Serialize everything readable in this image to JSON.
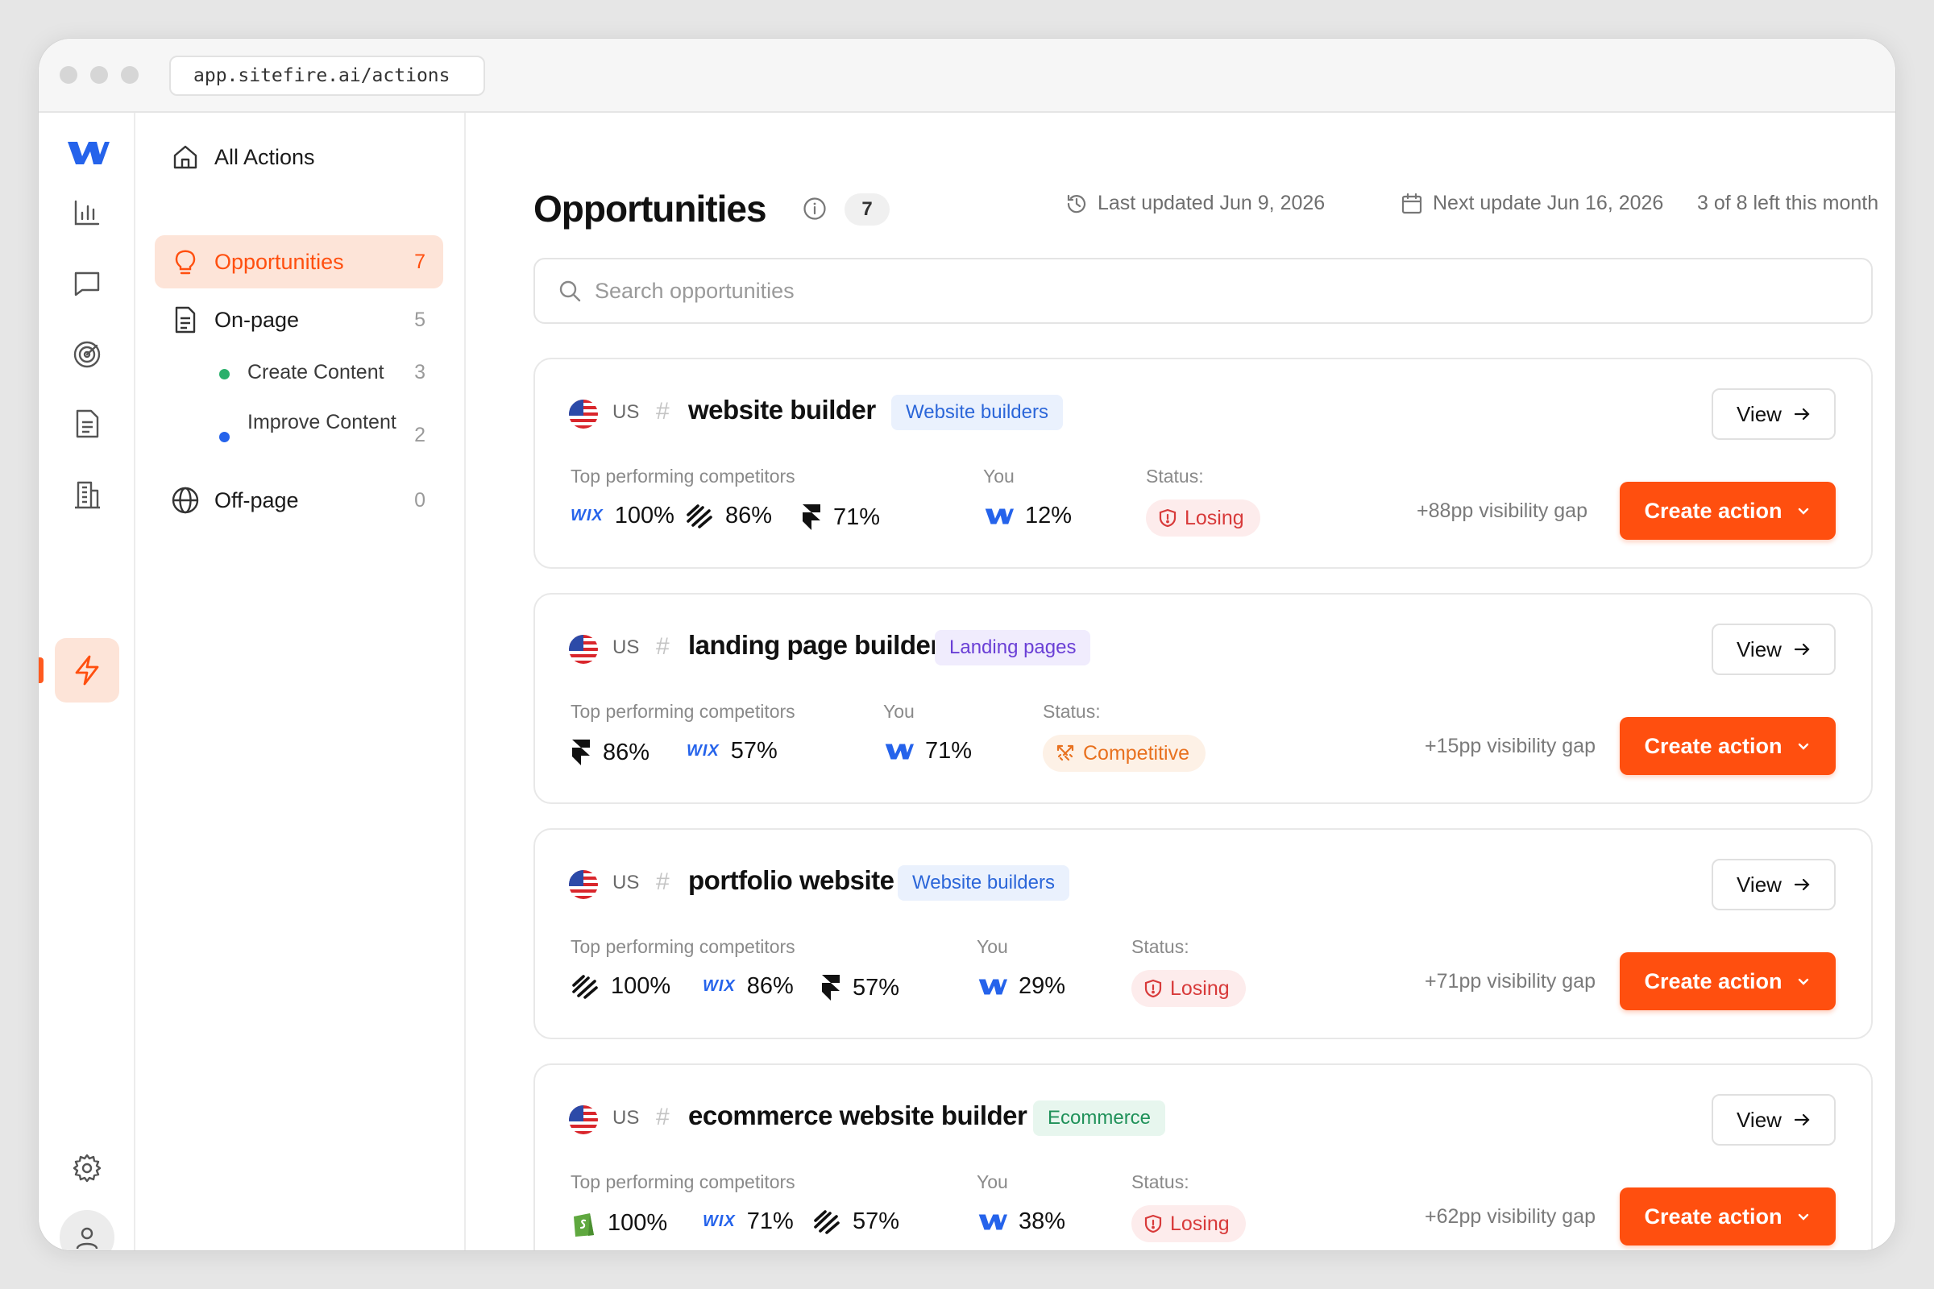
{
  "browser": {
    "url": "app.sitefire.ai/actions"
  },
  "sidebar": {
    "items": [
      {
        "label": "All Actions",
        "count": "",
        "icon": "home-icon"
      },
      {
        "label": "Opportunities",
        "count": "7",
        "icon": "lightbulb-icon",
        "active": true
      },
      {
        "label": "On-page",
        "count": "5",
        "icon": "document-icon"
      },
      {
        "label": "Off-page",
        "count": "0",
        "icon": "globe-icon"
      }
    ],
    "subitems": [
      {
        "label": "Create Content",
        "count": "3",
        "dot_color": "#2ab06b"
      },
      {
        "label": "Improve Content",
        "count": "2",
        "dot_color": "#2563eb"
      }
    ]
  },
  "page": {
    "title": "Opportunities",
    "count": "7",
    "last_updated": "Last updated Jun 9, 2026",
    "next_update": "Next update Jun 16, 2026",
    "quota": "3 of 8 left this month",
    "search_placeholder": "Search opportunities"
  },
  "labels": {
    "competitors": "Top performing competitors",
    "you": "You",
    "status": "Status:",
    "view": "View",
    "create_action": "Create action"
  },
  "cards": [
    {
      "country": "US",
      "keyword": "website builder",
      "tag": "Website builders",
      "tag_color": "blue",
      "competitors": [
        {
          "logo": "wix",
          "pct": "100%"
        },
        {
          "logo": "squarespace",
          "pct": "86%"
        },
        {
          "logo": "framer",
          "pct": "71%"
        }
      ],
      "you": "12%",
      "status": "Losing",
      "gap": "+88pp visibility gap"
    },
    {
      "country": "US",
      "keyword": "landing page builder",
      "tag": "Landing pages",
      "tag_color": "purple",
      "competitors": [
        {
          "logo": "framer",
          "pct": "86%"
        },
        {
          "logo": "wix",
          "pct": "57%"
        }
      ],
      "you": "71%",
      "status": "Competitive",
      "gap": "+15pp visibility gap"
    },
    {
      "country": "US",
      "keyword": "portfolio website",
      "tag": "Website builders",
      "tag_color": "blue",
      "competitors": [
        {
          "logo": "squarespace",
          "pct": "100%"
        },
        {
          "logo": "wix",
          "pct": "86%"
        },
        {
          "logo": "framer",
          "pct": "57%"
        }
      ],
      "you": "29%",
      "status": "Losing",
      "gap": "+71pp visibility gap"
    },
    {
      "country": "US",
      "keyword": "ecommerce website builder",
      "tag": "Ecommerce",
      "tag_color": "green",
      "competitors": [
        {
          "logo": "shopify",
          "pct": "100%"
        },
        {
          "logo": "wix",
          "pct": "71%"
        },
        {
          "logo": "squarespace",
          "pct": "57%"
        }
      ],
      "you": "38%",
      "status": "Losing",
      "gap": "+62pp visibility gap"
    }
  ],
  "colors": {
    "accent": "#ff4f0f",
    "accent_soft": "#fde4d8",
    "webflow_blue": "#2563eb"
  }
}
